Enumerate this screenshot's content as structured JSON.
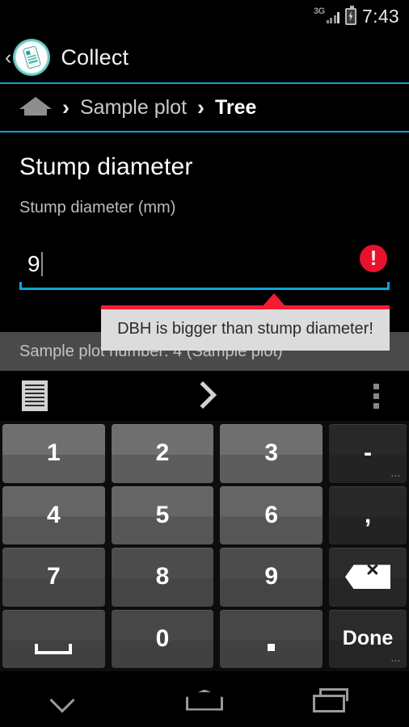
{
  "status_bar": {
    "network": "3G",
    "network_icon": "signal-bars-icon",
    "battery_icon": "battery-charging-icon",
    "time": "7:43"
  },
  "app_bar": {
    "back_caret": "‹",
    "logo_icon": "collect-app-logo",
    "title": "Collect"
  },
  "breadcrumb": {
    "home_icon": "home-icon",
    "separator": "›",
    "items": [
      {
        "label": "Sample plot",
        "current": false
      },
      {
        "label": "Tree",
        "current": true
      }
    ]
  },
  "form": {
    "title": "Stump diameter",
    "subtitle": "Stump diameter (mm)",
    "input": {
      "value": "9",
      "error_icon": "error-exclamation-icon",
      "error_mark": "!"
    },
    "validation_tooltip": {
      "message": "DBH is bigger than stump diameter!",
      "accent_color": "#f41c32",
      "background_color": "#dcdcdc"
    },
    "context_bar": {
      "text": "Sample plot number: 4 (Sample plot)"
    }
  },
  "toolbar": {
    "list_icon": "document-list-icon",
    "next_icon": "chevron-right-icon",
    "overflow_icon": "overflow-menu-icon"
  },
  "keyboard": {
    "rows": [
      [
        {
          "label": "1",
          "name": "key-1",
          "type": "num"
        },
        {
          "label": "2",
          "name": "key-2",
          "type": "num"
        },
        {
          "label": "3",
          "name": "key-3",
          "type": "num"
        },
        {
          "label": "-",
          "name": "key-minus",
          "type": "side",
          "hint": "..."
        }
      ],
      [
        {
          "label": "4",
          "name": "key-4",
          "type": "num"
        },
        {
          "label": "5",
          "name": "key-5",
          "type": "num"
        },
        {
          "label": "6",
          "name": "key-6",
          "type": "num"
        },
        {
          "label": ",",
          "name": "key-comma",
          "type": "side"
        }
      ],
      [
        {
          "label": "7",
          "name": "key-7",
          "type": "num"
        },
        {
          "label": "8",
          "name": "key-8",
          "type": "num"
        },
        {
          "label": "9",
          "name": "key-9",
          "type": "num"
        },
        {
          "label": "",
          "name": "key-backspace",
          "type": "side",
          "glyph": "backspace-icon"
        }
      ],
      [
        {
          "label": "",
          "name": "key-space",
          "type": "num",
          "glyph": "space-bar-icon"
        },
        {
          "label": "0",
          "name": "key-0",
          "type": "num"
        },
        {
          "label": "",
          "name": "key-period",
          "type": "num",
          "glyph": "period-icon"
        },
        {
          "label": "Done",
          "name": "key-done",
          "type": "side",
          "hint": "..."
        }
      ]
    ]
  },
  "nav_bar": {
    "back_icon": "hide-keyboard-chevron-icon",
    "home_icon": "home-outline-icon",
    "recents_icon": "recent-apps-icon"
  },
  "colors": {
    "accent_cyan": "#0fa3d6",
    "error_red": "#e8112d",
    "context_bar": "#4a4a4a"
  }
}
